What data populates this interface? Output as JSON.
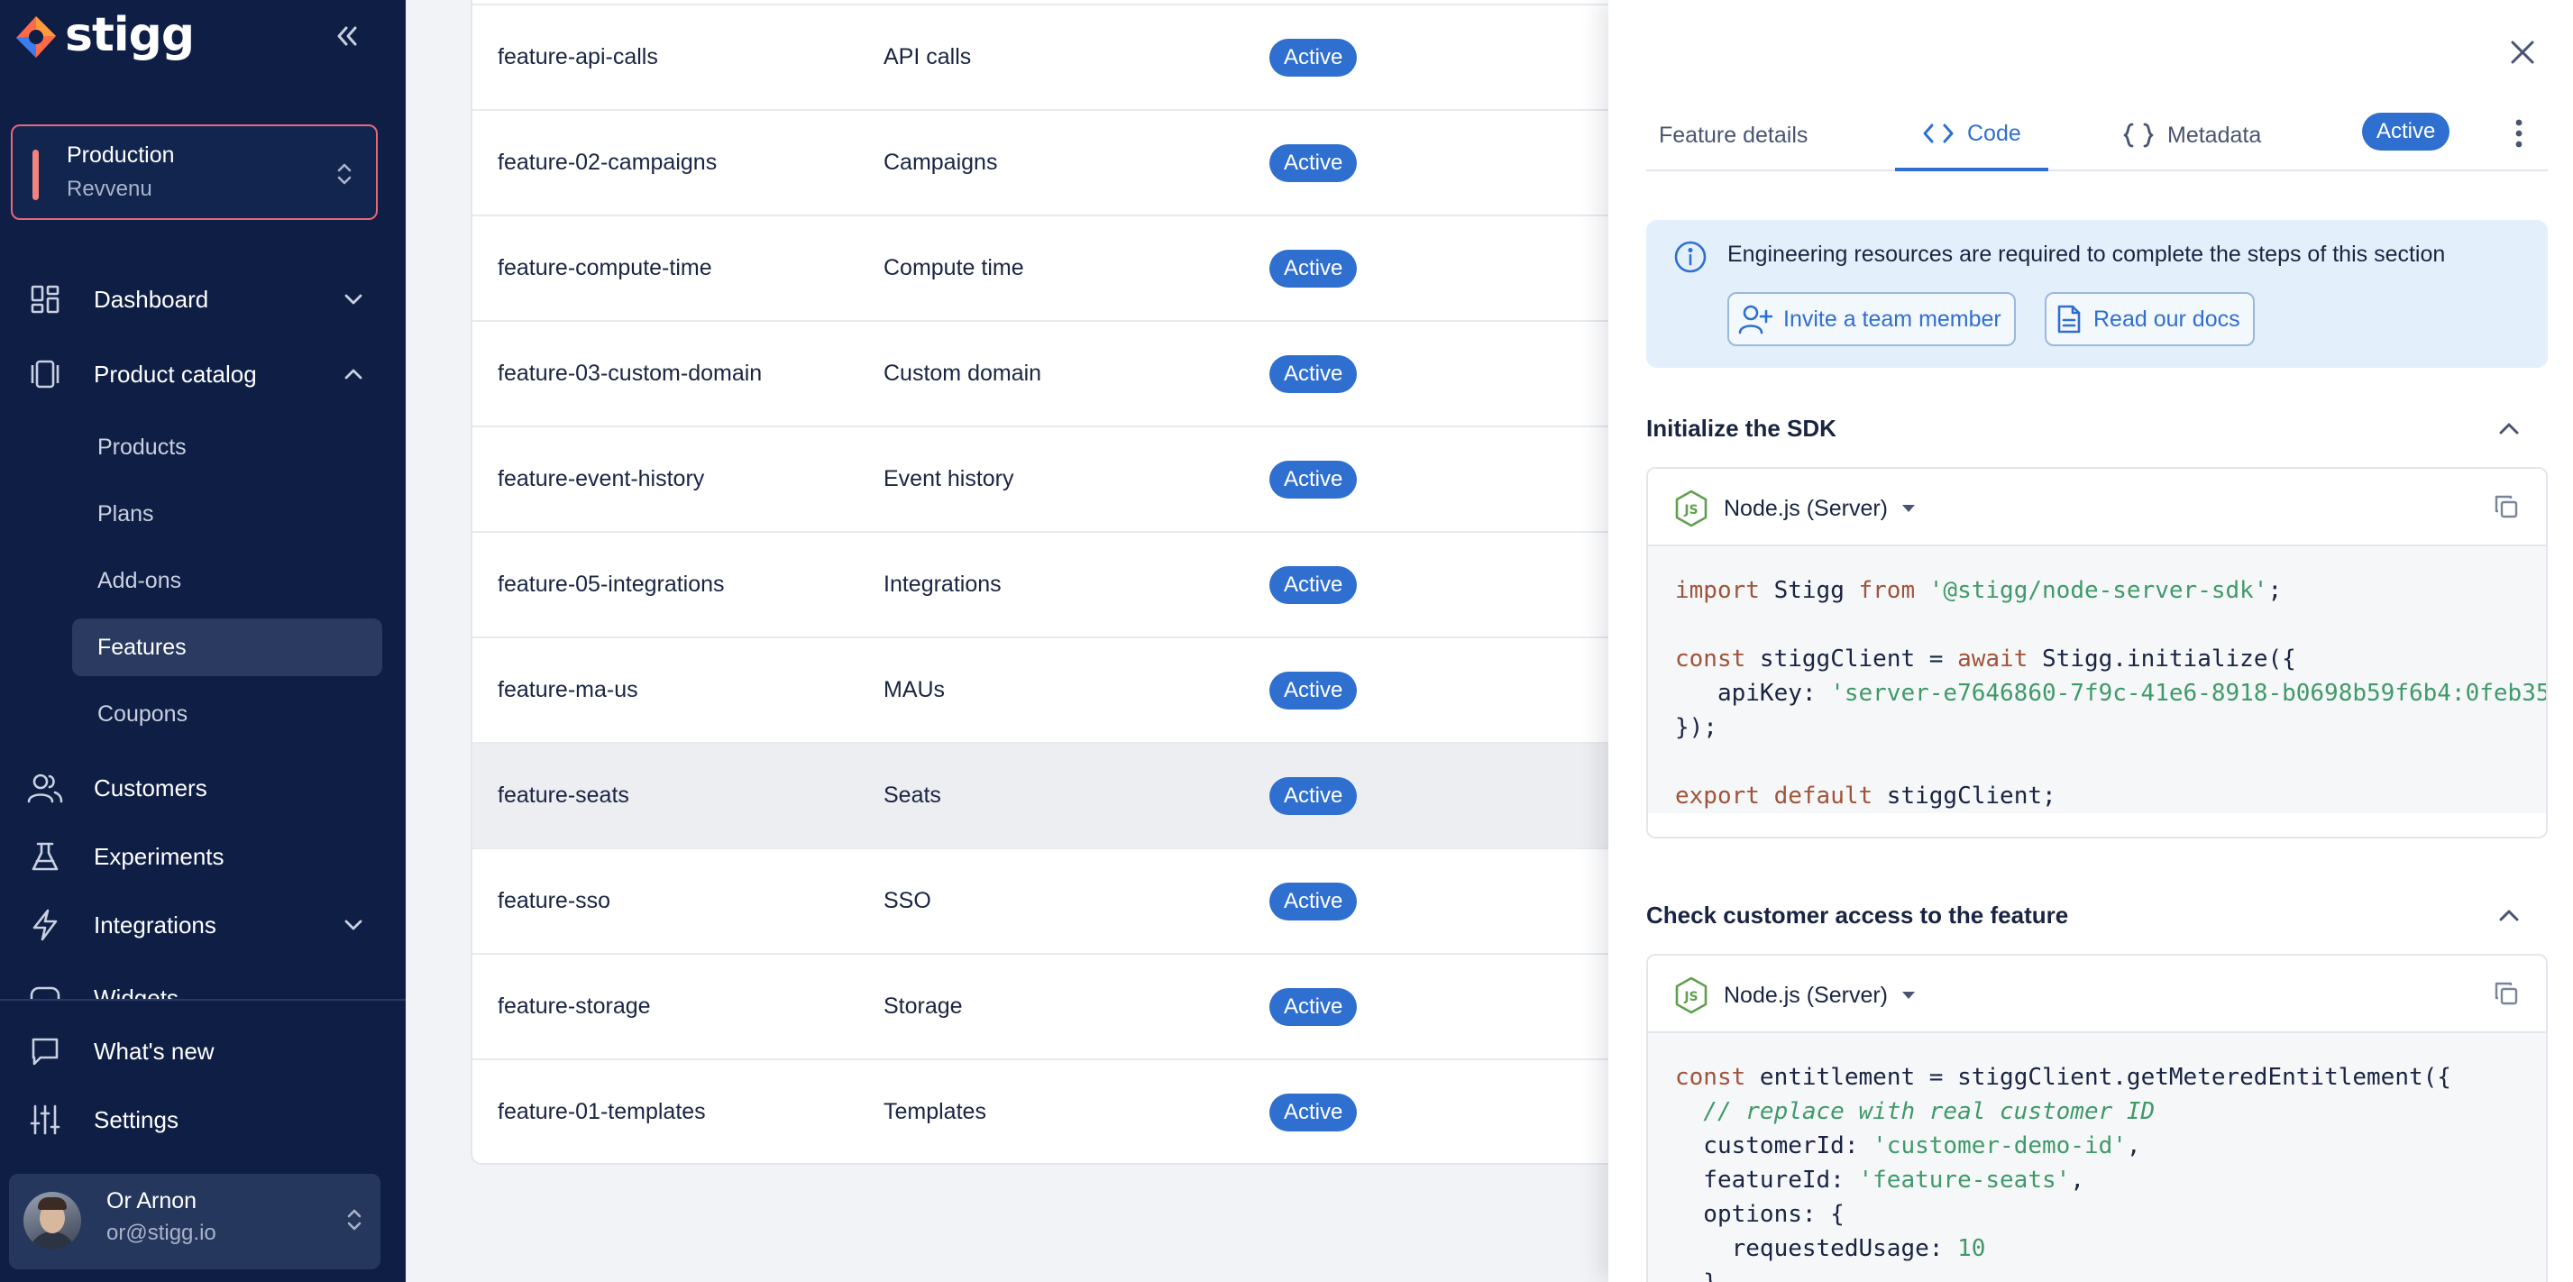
{
  "sidebar": {
    "brand": "stigg",
    "environment": {
      "name": "Production",
      "account": "Revvenu"
    },
    "nav": {
      "dashboard": "Dashboard",
      "product_catalog": "Product catalog",
      "products": "Products",
      "plans": "Plans",
      "addons": "Add-ons",
      "features": "Features",
      "coupons": "Coupons",
      "customers": "Customers",
      "experiments": "Experiments",
      "integrations": "Integrations",
      "widgets": "Widgets",
      "whats_new": "What's new",
      "settings": "Settings"
    },
    "selected_item": "Features",
    "user": {
      "name": "Or Arnon",
      "email": "or@stigg.io"
    }
  },
  "features_table": {
    "rows": [
      {
        "id": "feature-api-calls",
        "name": "API calls",
        "status": "Active"
      },
      {
        "id": "feature-02-campaigns",
        "name": "Campaigns",
        "status": "Active"
      },
      {
        "id": "feature-compute-time",
        "name": "Compute time",
        "status": "Active"
      },
      {
        "id": "feature-03-custom-domain",
        "name": "Custom domain",
        "status": "Active"
      },
      {
        "id": "feature-event-history",
        "name": "Event history",
        "status": "Active"
      },
      {
        "id": "feature-05-integrations",
        "name": "Integrations",
        "status": "Active"
      },
      {
        "id": "feature-ma-us",
        "name": "MAUs",
        "status": "Active"
      },
      {
        "id": "feature-seats",
        "name": "Seats",
        "status": "Active"
      },
      {
        "id": "feature-sso",
        "name": "SSO",
        "status": "Active"
      },
      {
        "id": "feature-storage",
        "name": "Storage",
        "status": "Active"
      },
      {
        "id": "feature-01-templates",
        "name": "Templates",
        "status": "Active"
      }
    ],
    "highlighted_row": "feature-seats"
  },
  "drawer": {
    "tabs": {
      "details": "Feature details",
      "code": "Code",
      "metadata": "Metadata"
    },
    "active_tab": "Code",
    "status_badge": "Active",
    "info": {
      "text": "Engineering resources are required to complete the steps of this section",
      "invite": "Invite a team member",
      "docs": "Read our docs"
    },
    "sections": {
      "init": {
        "title": "Initialize the SDK",
        "language": "Node.js (Server)",
        "code": {
          "import_kw": "import",
          "import_name": " Stigg ",
          "from_kw": "from",
          "package": "'@stigg/node-server-sdk'",
          "semicolon": ";",
          "const_kw": "const",
          "client_decl": " stiggClient = ",
          "await_kw": "await",
          "init_call": " Stigg.initialize({",
          "apikey_label": "   apiKey: ",
          "apikey_value": "'server-e7646860-7f9c-41e6-8918-b0698b59f6b4:0feb35",
          "close": "});",
          "export_kw": "export",
          "default_kw": "default",
          "export_name": " stiggClient;"
        }
      },
      "access": {
        "title": "Check customer access to the feature",
        "language": "Node.js (Server)",
        "code": {
          "const_kw": "const",
          "call": " entitlement = stiggClient.getMeteredEntitlement({",
          "comment": "  // replace with real customer ID",
          "customer_label": "  customerId: ",
          "customer_value": "'customer-demo-id'",
          "feature_label": "  featureId: ",
          "feature_value": "'feature-seats'",
          "options": "  options: {",
          "usage_label": "    requestedUsage: ",
          "usage_value": "10",
          "options_close": "  },"
        }
      }
    }
  },
  "colors": {
    "sidebar_bg": "#0e1e45",
    "accent_blue": "#2f6fcf",
    "environment_accent": "#e8677a",
    "code_keyword": "#a0543a",
    "code_string": "#3f9a6a"
  }
}
